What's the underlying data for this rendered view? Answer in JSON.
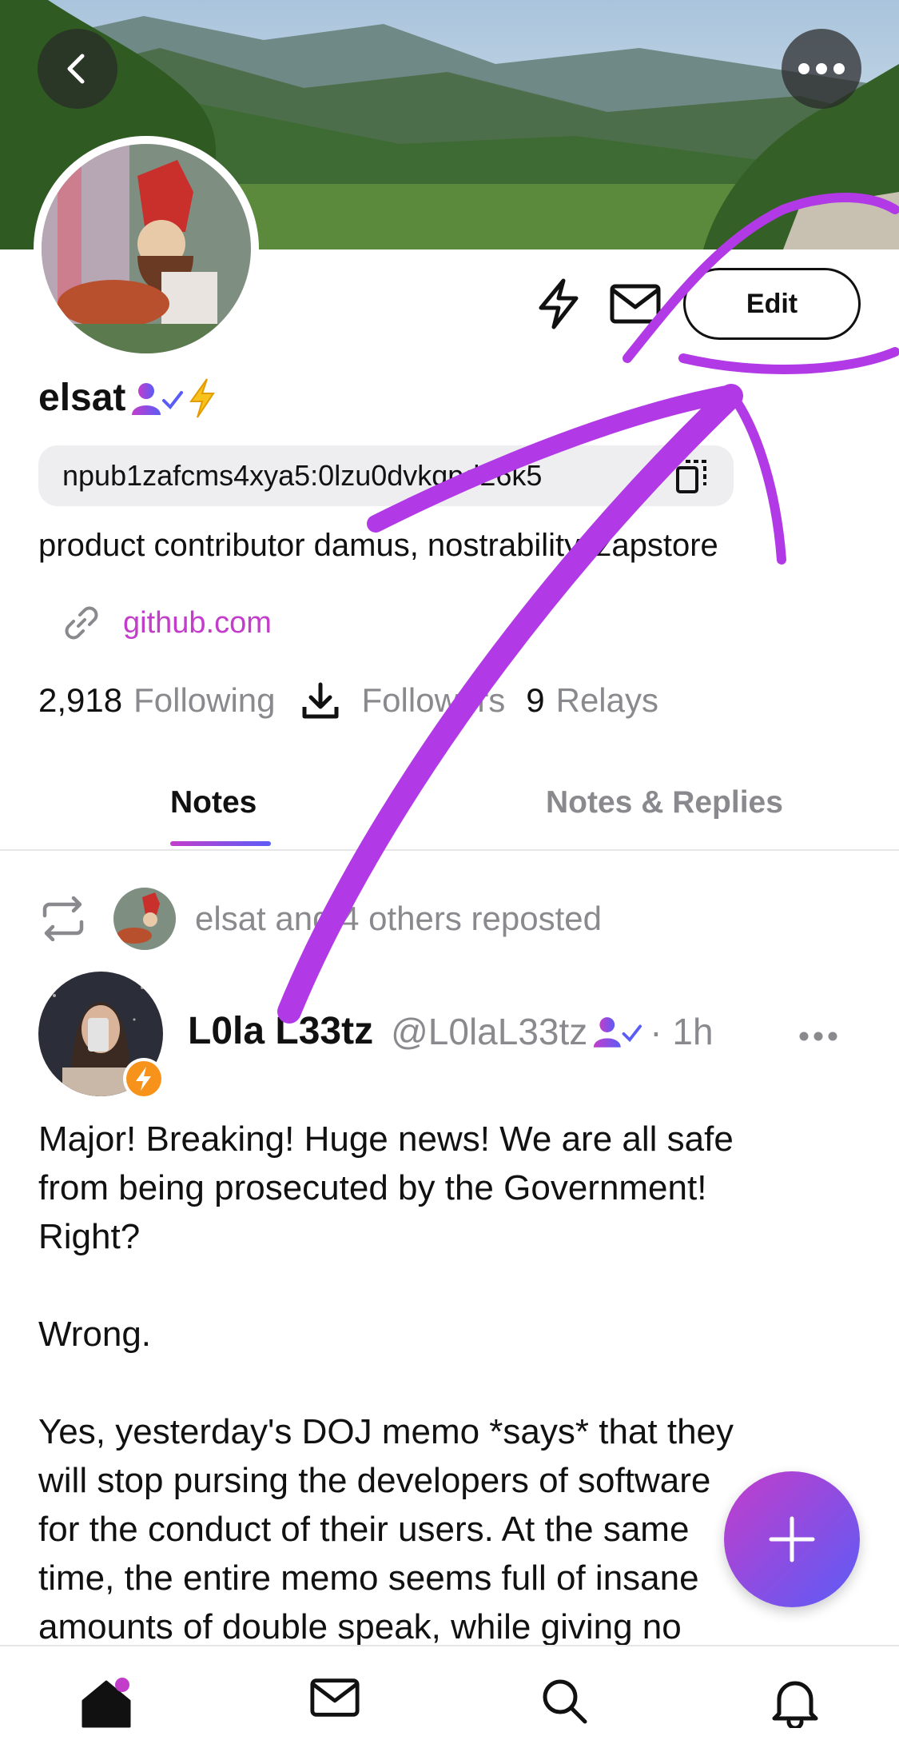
{
  "header": {
    "back_icon": "chevron-left-icon",
    "more_icon": "ellipsis-icon"
  },
  "profile": {
    "name": "elsat",
    "npub": "npub1zafcms4xya5:0lzu0dvkqpd26k5",
    "bio": "product contributor damus, nostrability, zapstore",
    "website": "github.com",
    "edit_label": "Edit"
  },
  "stats": {
    "following_count": "2,918",
    "following_label": "Following",
    "followers_label": "Followers",
    "relays_count": "9",
    "relays_label": "Relays"
  },
  "tabs": [
    {
      "label": "Notes",
      "active": true
    },
    {
      "label": "Notes & Replies",
      "active": false
    }
  ],
  "repost": {
    "text": "elsat and 4 others reposted"
  },
  "post": {
    "author_name": "L0la L33tz",
    "handle": "@L0laL33tz",
    "time": "· 1h",
    "body_lines": [
      "Major! Breaking! Huge news! We are all safe",
      "from being prosecuted by the Government!",
      "Right?",
      "",
      "Wrong.",
      "",
      "Yes, yesterday's DOJ memo *says* that they",
      "will stop pursing the developers of software",
      "for the conduct of their users. At the same",
      "time, the entire memo seems full of insane",
      "amounts of double speak, while giving no"
    ]
  },
  "bottom_nav": [
    {
      "name": "home",
      "icon": "home-icon"
    },
    {
      "name": "messages",
      "icon": "mail-icon"
    },
    {
      "name": "search",
      "icon": "search-icon"
    },
    {
      "name": "notifications",
      "icon": "bell-icon"
    }
  ],
  "colors": {
    "accent_purple": "#c33dcb",
    "accent_blue": "#5b5cf6",
    "annotation_stroke": "#b13ae6",
    "muted_text": "#8a8a8e"
  }
}
